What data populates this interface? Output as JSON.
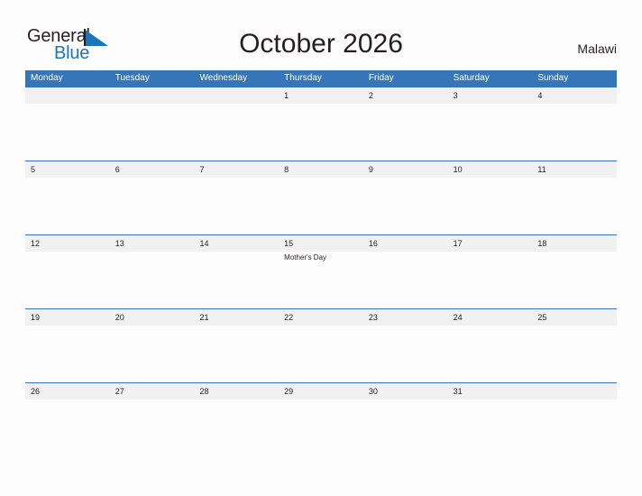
{
  "brand": {
    "name_line1": "General",
    "name_line2": "Blue",
    "triangle_color": "#1b75bb",
    "text_color_line1": "#231f20",
    "text_color_line2": "#1b75bb",
    "triangle_icon": "triangle-right-icon"
  },
  "header": {
    "title": "October 2026",
    "country": "Malawi"
  },
  "theme": {
    "header_blue": "#3575b8",
    "row_band_gray": "#f1f1f1",
    "text_dark": "#231f20",
    "page_background": "#fdfdfd"
  },
  "calendar": {
    "month": "October",
    "year": "2026",
    "weekday_headers": [
      "Monday",
      "Tuesday",
      "Wednesday",
      "Thursday",
      "Friday",
      "Saturday",
      "Sunday"
    ],
    "weeks": [
      [
        {
          "day": "",
          "event": ""
        },
        {
          "day": "",
          "event": ""
        },
        {
          "day": "",
          "event": ""
        },
        {
          "day": "1",
          "event": ""
        },
        {
          "day": "2",
          "event": ""
        },
        {
          "day": "3",
          "event": ""
        },
        {
          "day": "4",
          "event": ""
        }
      ],
      [
        {
          "day": "5",
          "event": ""
        },
        {
          "day": "6",
          "event": ""
        },
        {
          "day": "7",
          "event": ""
        },
        {
          "day": "8",
          "event": ""
        },
        {
          "day": "9",
          "event": ""
        },
        {
          "day": "10",
          "event": ""
        },
        {
          "day": "11",
          "event": ""
        }
      ],
      [
        {
          "day": "12",
          "event": ""
        },
        {
          "day": "13",
          "event": ""
        },
        {
          "day": "14",
          "event": ""
        },
        {
          "day": "15",
          "event": "Mother's Day"
        },
        {
          "day": "16",
          "event": ""
        },
        {
          "day": "17",
          "event": ""
        },
        {
          "day": "18",
          "event": ""
        }
      ],
      [
        {
          "day": "19",
          "event": ""
        },
        {
          "day": "20",
          "event": ""
        },
        {
          "day": "21",
          "event": ""
        },
        {
          "day": "22",
          "event": ""
        },
        {
          "day": "23",
          "event": ""
        },
        {
          "day": "24",
          "event": ""
        },
        {
          "day": "25",
          "event": ""
        }
      ],
      [
        {
          "day": "26",
          "event": ""
        },
        {
          "day": "27",
          "event": ""
        },
        {
          "day": "28",
          "event": ""
        },
        {
          "day": "29",
          "event": ""
        },
        {
          "day": "30",
          "event": ""
        },
        {
          "day": "31",
          "event": ""
        },
        {
          "day": "",
          "event": ""
        }
      ]
    ]
  }
}
